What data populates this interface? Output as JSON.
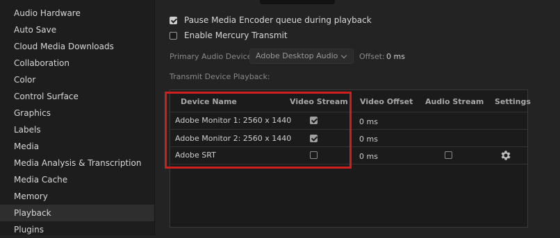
{
  "sidebar": {
    "items": [
      {
        "label": "Audio Hardware"
      },
      {
        "label": "Auto Save"
      },
      {
        "label": "Cloud Media Downloads"
      },
      {
        "label": "Collaboration"
      },
      {
        "label": "Color"
      },
      {
        "label": "Control Surface"
      },
      {
        "label": "Graphics"
      },
      {
        "label": "Labels"
      },
      {
        "label": "Media"
      },
      {
        "label": "Media Analysis & Transcription"
      },
      {
        "label": "Media Cache"
      },
      {
        "label": "Memory"
      },
      {
        "label": "Playback",
        "selected": true
      },
      {
        "label": "Plugins"
      }
    ]
  },
  "options": {
    "pause_queue": {
      "label": "Pause Media Encoder queue during playback",
      "checked": true
    },
    "mercury_transmit": {
      "label": "Enable Mercury Transmit",
      "checked": false
    }
  },
  "audio": {
    "device_label": "Primary Audio Device:",
    "device_value": "Adobe Desktop Audio",
    "offset_label": "Offset:",
    "offset_value": "0 ms"
  },
  "transmit": {
    "label": "Transmit Device Playback:"
  },
  "table": {
    "headers": [
      "Device Name",
      "Video Stream",
      "Video Offset",
      "Audio Stream",
      "Settings"
    ],
    "rows": [
      {
        "name": "Adobe Monitor 1: 2560 x 1440",
        "video_stream": true,
        "video_offset": "0 ms"
      },
      {
        "name": "Adobe Monitor 2: 2560 x 1440",
        "video_stream": true,
        "video_offset": "0 ms"
      },
      {
        "name": "Adobe SRT",
        "video_stream": false,
        "video_offset": "0 ms",
        "audio_stream": false,
        "settings_icon": "gear-icon"
      }
    ]
  },
  "colors": {
    "highlight": "#d11f1f",
    "background": "#232323",
    "sidebar": "#1d1d1d"
  }
}
